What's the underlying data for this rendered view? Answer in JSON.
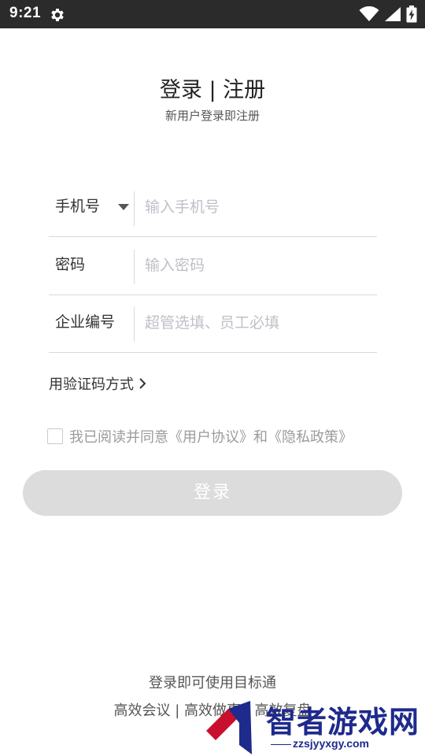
{
  "status_bar": {
    "time": "9:21",
    "icons": [
      "gear-icon",
      "wifi-icon",
      "signal-icon",
      "battery-charging-icon"
    ]
  },
  "header": {
    "title": "登录 | 注册",
    "subtitle": "新用户登录即注册"
  },
  "form": {
    "phone": {
      "label": "手机号",
      "placeholder": "输入手机号",
      "value": ""
    },
    "password": {
      "label": "密码",
      "placeholder": "输入密码",
      "value": ""
    },
    "company": {
      "label": "企业编号",
      "placeholder": "超管选填、员工必填",
      "value": ""
    }
  },
  "alt_login": {
    "label": "用验证码方式"
  },
  "agreement": {
    "text": "我已阅读并同意《用户协议》和《隐私政策》",
    "checked": false
  },
  "login_button": {
    "label": "登录",
    "enabled": false
  },
  "footer": {
    "line1": "登录即可使用目标通",
    "line2": "高效会议 | 高效做事 | 高效复盘"
  },
  "watermark": {
    "text": "智者游戏网",
    "url": "zzsjyyxgy.com"
  },
  "colors": {
    "status_bar_bg": "#2b2b2b",
    "divider": "#d9d9de",
    "placeholder": "#bfc0c8",
    "button_disabled_bg": "#dcdcdc",
    "watermark": "#1e2a8c"
  }
}
